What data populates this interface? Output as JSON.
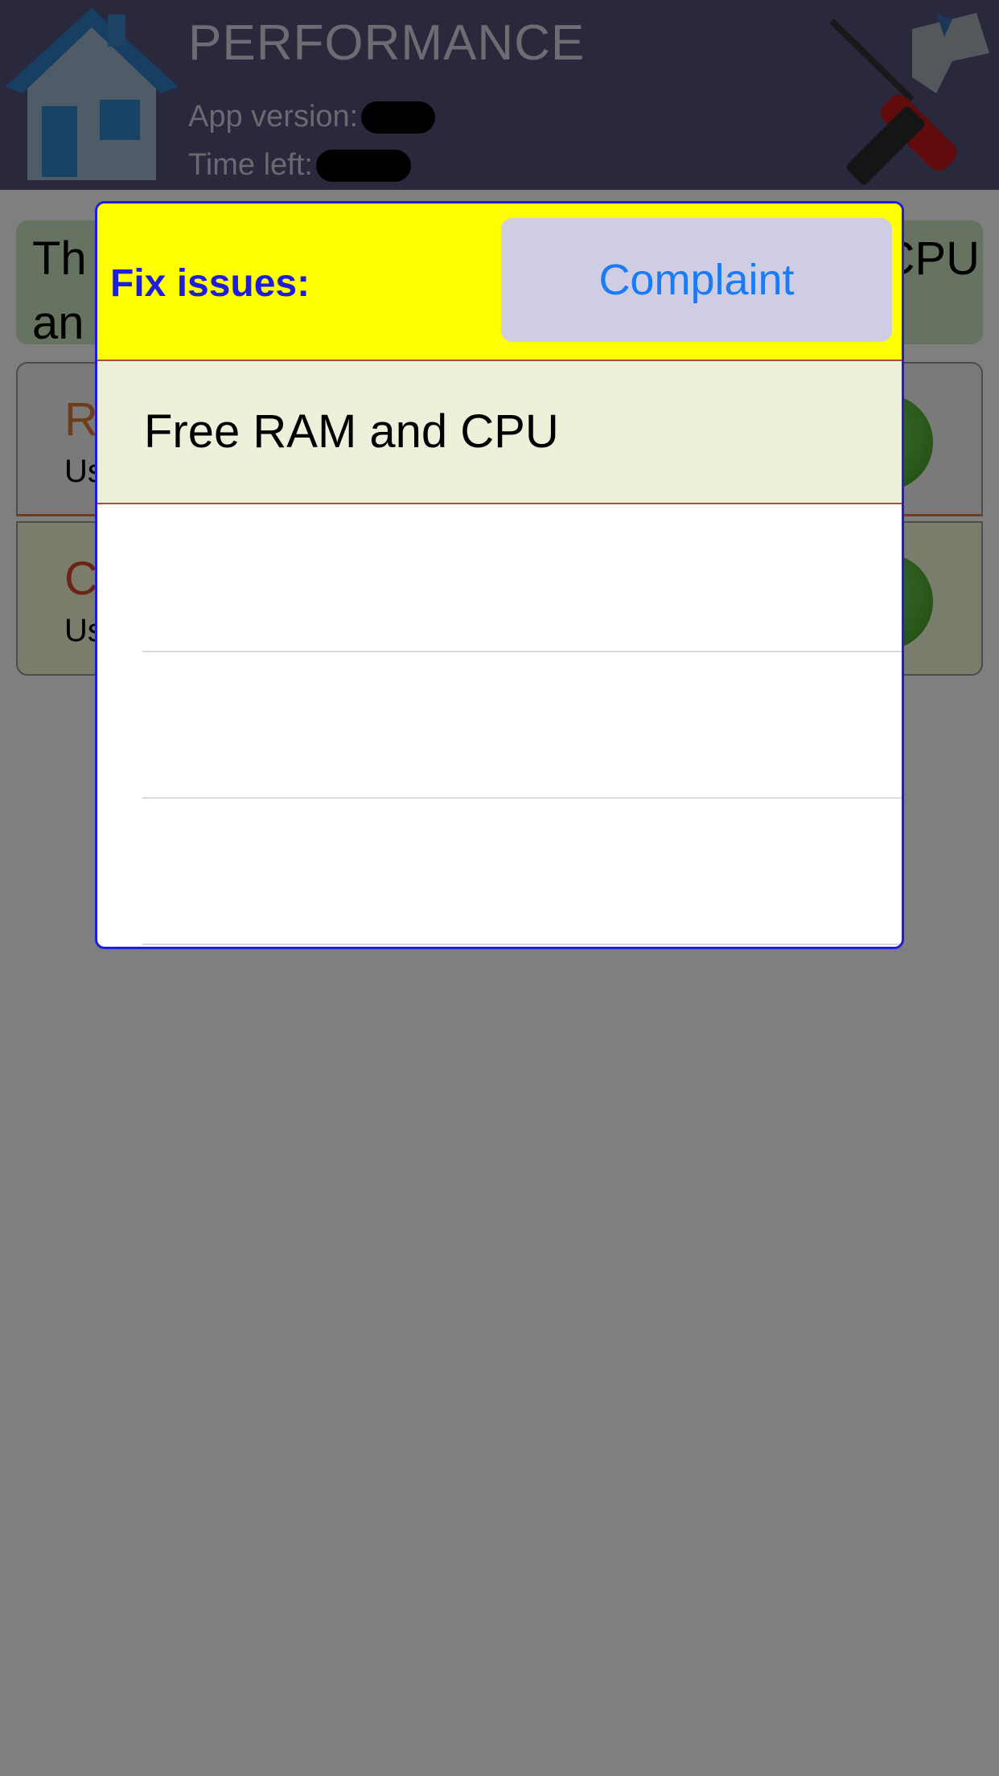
{
  "header": {
    "title": "PERFORMANCE",
    "app_version_label": "App version:",
    "time_left_label": "Time left:",
    "home_icon": "home-icon",
    "tools_icon": "tools-icon"
  },
  "banner": {
    "line1_start": "Th",
    "line1_end": "CPU",
    "line2_start": "an"
  },
  "cards": {
    "ram": {
      "title": "R",
      "sub": "Us"
    },
    "cpu": {
      "title": "C",
      "sub": "Us"
    }
  },
  "popover": {
    "title": "Fix issues:",
    "complaint_label": "Complaint",
    "options": [
      "Free RAM and CPU"
    ]
  },
  "colors": {
    "header_bg": "#54517a",
    "popover_header_bg": "#ffff00",
    "popover_border": "#1d1ddb",
    "button_text": "#1b7bf5",
    "button_bg": "#cfcde3",
    "selected_row_bg": "#eef0da"
  }
}
